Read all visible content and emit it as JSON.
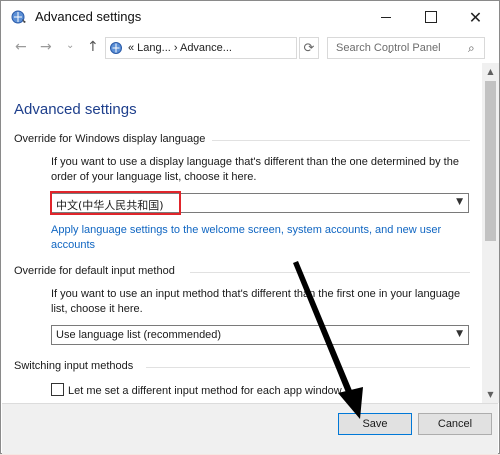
{
  "window": {
    "title": "Advanced settings",
    "controls": {
      "minimize": "",
      "maximize": "",
      "close": "✕"
    }
  },
  "nav": {
    "back": "←",
    "forward": "→",
    "recent": "⌄",
    "up": "↑",
    "address": "« Lang... › Advance...",
    "address_dropdown": "⌄",
    "refresh": "⟳",
    "search_placeholder": "Search Control Panel",
    "search_icon": "⌕"
  },
  "page": {
    "title": "Advanced settings",
    "display_language": {
      "heading": "Override for Windows display language",
      "description": "If you want to use a display language that's different than the one determined by the order of your language list, choose it here.",
      "selected": "中文(中华人民共和国)",
      "link": "Apply language settings to the welcome screen, system accounts, and new user accounts"
    },
    "input_method": {
      "heading": "Override for default input method",
      "description": "If you want to use an input method that's different than the first one in your language list, choose it here.",
      "selected": "Use language list (recommended)"
    },
    "switching": {
      "heading": "Switching input methods",
      "checkbox_label": "Let me set a different input method for each app window"
    }
  },
  "scrollbar": {
    "up": "▲",
    "down": "▼"
  },
  "footer": {
    "save": "Save",
    "cancel": "Cancel"
  },
  "colors": {
    "title_blue": "#1e3f8c",
    "link_blue": "#1066c2",
    "highlight_red": "#e0252b"
  }
}
